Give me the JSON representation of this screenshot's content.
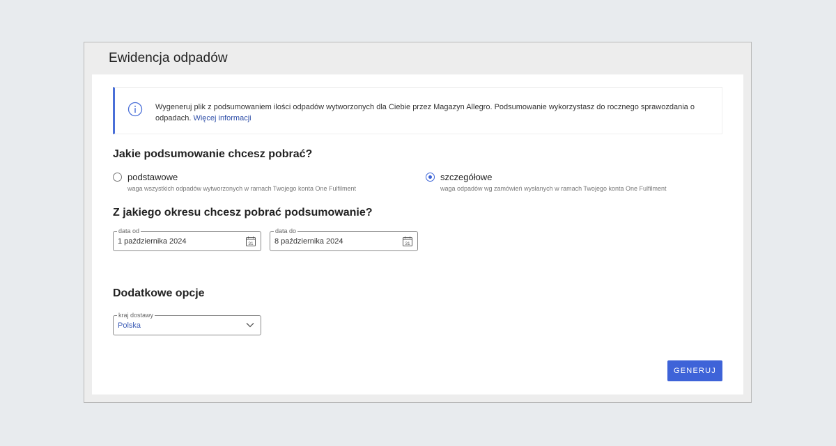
{
  "page": {
    "title": "Ewidencja odpadów"
  },
  "info": {
    "text": "Wygeneruj plik z podsumowaniem ilości odpadów wytworzonych dla Ciebie przez Magazyn Allegro. Podsumowanie wykorzystasz do rocznego sprawozdania o odpadach.",
    "link": "Więcej informacji",
    "icon": "info-icon"
  },
  "summary": {
    "title": "Jakie podsumowanie chcesz pobrać?",
    "options": [
      {
        "label": "podstawowe",
        "description": "waga wszystkich odpadów wytworzonych w ramach Twojego konta One Fulfilment",
        "checked": false
      },
      {
        "label": "szczegółowe",
        "description": "waga odpadów wg zamówień wysłanych w ramach Twojego konta One Fulfilment",
        "checked": true
      }
    ]
  },
  "period": {
    "title": "Z jakiego okresu chcesz pobrać podsumowanie?",
    "from": {
      "label": "data od",
      "value": "1 października 2024"
    },
    "to": {
      "label": "data do",
      "value": "8 października 2024"
    },
    "calendar_icon_text": "31"
  },
  "extra": {
    "title": "Dodatkowe opcje",
    "country": {
      "label": "kraj dostawy",
      "value": "Polska"
    }
  },
  "actions": {
    "generate_label": "GENERUJ"
  },
  "colors": {
    "accent": "#3e63d8",
    "background": "#e8ebee",
    "frame": "#ededed"
  }
}
